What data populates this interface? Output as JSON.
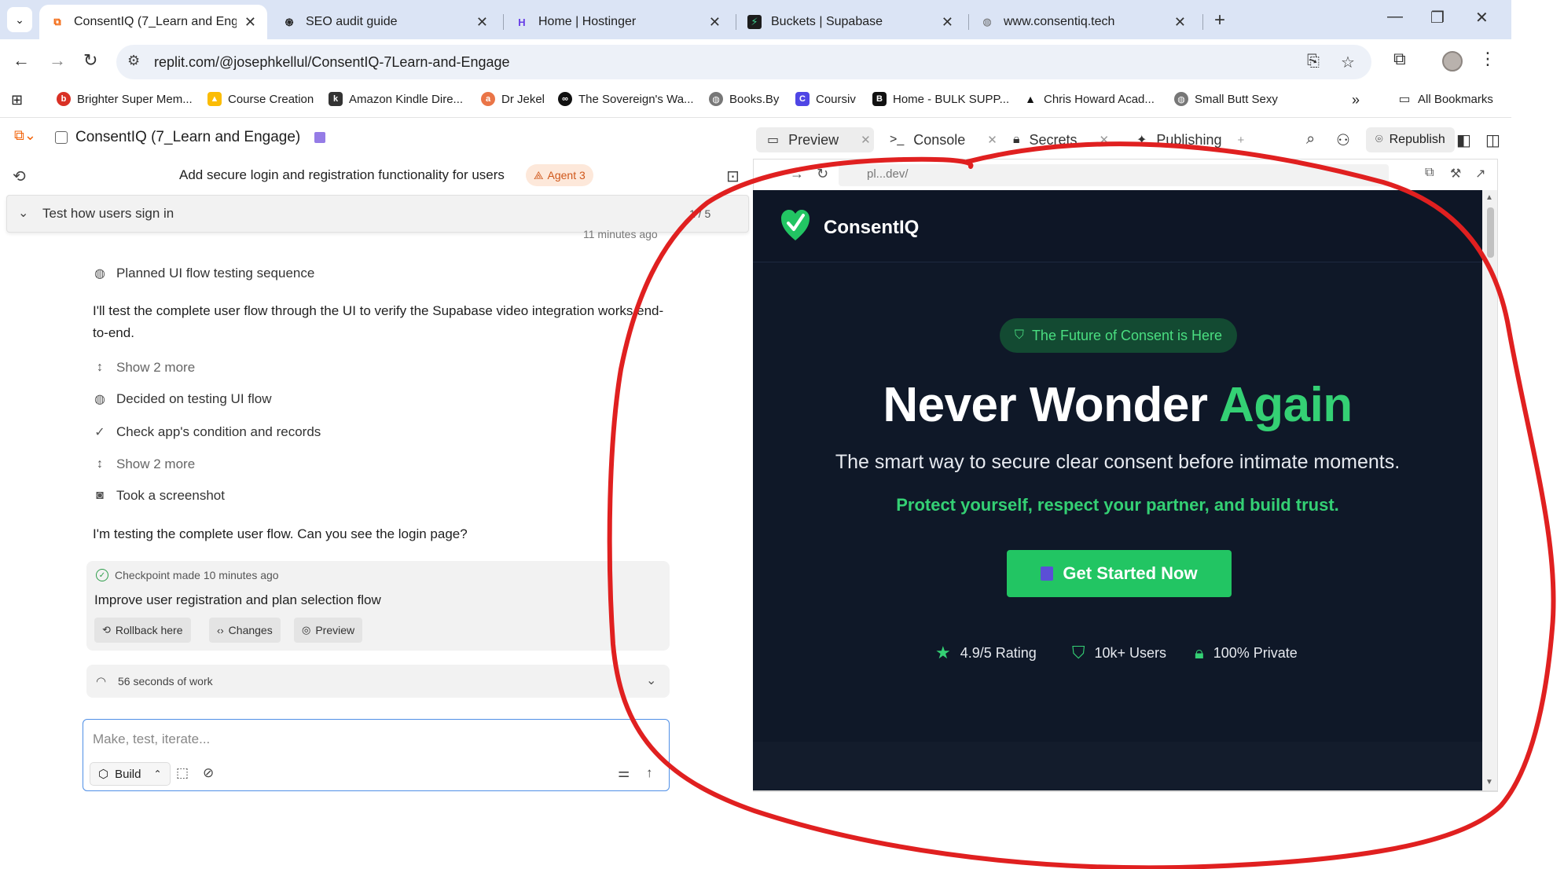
{
  "browser": {
    "tabs": [
      {
        "title": "ConsentIQ (7_Learn and Engage",
        "active": true
      },
      {
        "title": "SEO audit guide"
      },
      {
        "title": "Home | Hostinger"
      },
      {
        "title": "Buckets | Supabase"
      },
      {
        "title": "www.consentiq.tech"
      }
    ],
    "url": "replit.com/@josephkellul/ConsentIQ-7Learn-and-Engage",
    "bookmarks": [
      "Brighter Super Mem...",
      "Course Creation",
      "Amazon Kindle Dire...",
      "Dr Jekel",
      "The Sovereign's Wa...",
      "Books.By",
      "Coursiv",
      "Home - BULK SUPP...",
      "Chris Howard Acad...",
      "Small Butt Sexy"
    ],
    "all_bookmarks": "All Bookmarks"
  },
  "replit": {
    "project_title": "ConsentIQ (7_Learn and Engage)",
    "panel_tabs": {
      "preview": "Preview",
      "console": "Console",
      "secrets": "Secrets",
      "publishing": "Publishing"
    },
    "republish": "Republish"
  },
  "chat": {
    "title": "Add secure login and registration functionality for users",
    "agent_badge": "Agent 3",
    "test_card": {
      "label": "Test how users sign in",
      "page": "1 / 5"
    },
    "time_ago": "11 minutes ago",
    "step_planned": "Planned UI flow testing sequence",
    "paragraph1": "I'll test the complete user flow through the UI to verify the Supabase video integration works end-to-end.",
    "show_more_1": "Show 2 more",
    "step_decided": "Decided on testing UI flow",
    "step_check": "Check app's condition and records",
    "show_more_2": "Show 2 more",
    "step_screenshot": "Took a screenshot",
    "paragraph2": "I'm testing the complete user flow. Can you see the login page?",
    "checkpoint": {
      "label": "Checkpoint made 10 minutes ago",
      "title": "Improve user registration and plan selection flow",
      "rollback": "Rollback here",
      "changes": "Changes",
      "preview": "Preview"
    },
    "work": "56 seconds of work",
    "composer": {
      "placeholder": "Make, test, iterate...",
      "mode": "Build"
    }
  },
  "preview": {
    "url": "pl...dev/",
    "brand": "ConsentIQ",
    "pill": "The Future of Consent is Here",
    "heading_main": "Never Wonder ",
    "heading_accent": "Again",
    "subtitle": "The smart way to secure clear consent before intimate moments.",
    "subtitle2": "Protect yourself, respect your partner, and build trust.",
    "cta": "Get Started Now",
    "stats": {
      "rating": "4.9/5 Rating",
      "users": "10k+ Users",
      "private": "100% Private"
    }
  },
  "colors": {
    "accent_green": "#34d074",
    "site_bg": "#0f1828",
    "replit_orange": "#f26207",
    "annotation_red": "#e02020"
  }
}
